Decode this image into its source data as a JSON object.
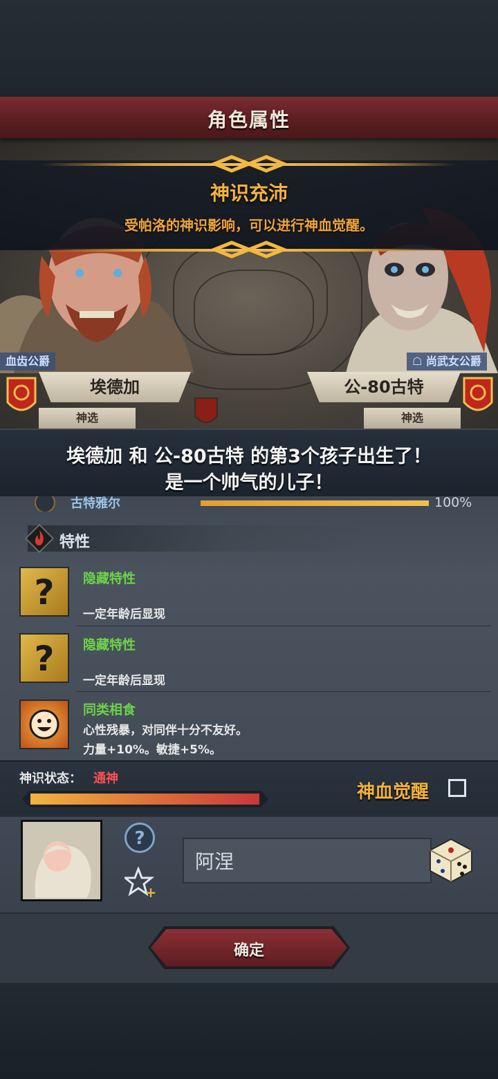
{
  "window": {
    "title": "角色属性"
  },
  "banner": {
    "title": "神识充沛",
    "description": "受帕洛的神识影响，可以进行神血觉醒。"
  },
  "parents": {
    "left": {
      "title": "血齿公爵",
      "name": "埃德加",
      "sub": "神选"
    },
    "right": {
      "title": "尚武女公爵",
      "name": "公-80古特",
      "sub": "神选"
    }
  },
  "birth_message": {
    "line1": "埃德加 和 公-80古特 的第3个孩子出生了！",
    "line2": "是一个帅气的儿子！"
  },
  "partial_row": {
    "name": "古特雅尔",
    "value": "100%"
  },
  "traits": {
    "heading": "特性",
    "items": [
      {
        "name": "隐藏特性",
        "desc": "一定年龄后显现",
        "icon": "question-icon"
      },
      {
        "name": "隐藏特性",
        "desc": "一定年龄后显现",
        "icon": "question-icon"
      },
      {
        "name": "同类相食",
        "desc": "心性残暴，对同伴十分不友好。",
        "desc2": "力量+10%。敏捷+5%。",
        "icon": "smiley-sun-icon"
      }
    ]
  },
  "status": {
    "label": "神识状态：",
    "value": "通神",
    "progress": 0.95,
    "awaken_label": "神血觉醒",
    "awaken_checked": false
  },
  "child": {
    "name_value": "阿涅"
  },
  "confirm_label": "确定",
  "colors": {
    "accent_gold": "#f3b43a",
    "trait_green": "#6cd24a",
    "status_red": "#ff5050",
    "title_red": "#7a2c30"
  }
}
